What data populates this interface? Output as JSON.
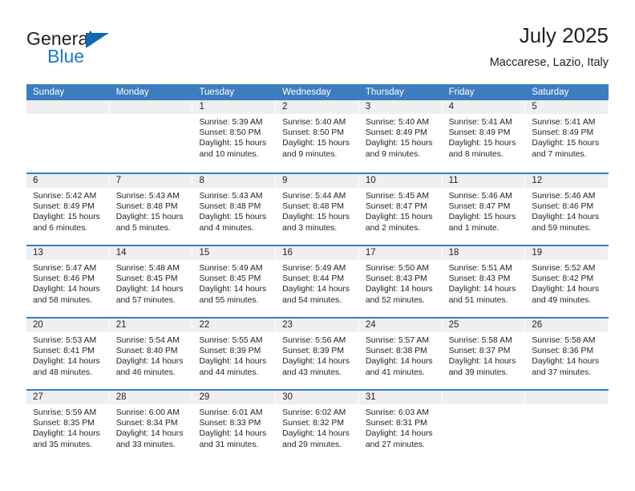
{
  "brand": {
    "name_part1": "General",
    "name_part2": "Blue",
    "triangle_color": "#1068b5",
    "blue_text_color": "#1f7ac4"
  },
  "header": {
    "title": "July 2025",
    "subtitle": "Maccarese, Lazio, Italy"
  },
  "theme": {
    "header_blue": "#3b7dbf",
    "daynum_band": "#efefef",
    "text": "#231f20"
  },
  "weekdays": [
    "Sunday",
    "Monday",
    "Tuesday",
    "Wednesday",
    "Thursday",
    "Friday",
    "Saturday"
  ],
  "weeks": [
    [
      {
        "day": "",
        "sunrise": "",
        "sunset": "",
        "daylight1": "",
        "daylight2": ""
      },
      {
        "day": "",
        "sunrise": "",
        "sunset": "",
        "daylight1": "",
        "daylight2": ""
      },
      {
        "day": "1",
        "sunrise": "Sunrise: 5:39 AM",
        "sunset": "Sunset: 8:50 PM",
        "daylight1": "Daylight: 15 hours",
        "daylight2": "and 10 minutes."
      },
      {
        "day": "2",
        "sunrise": "Sunrise: 5:40 AM",
        "sunset": "Sunset: 8:50 PM",
        "daylight1": "Daylight: 15 hours",
        "daylight2": "and 9 minutes."
      },
      {
        "day": "3",
        "sunrise": "Sunrise: 5:40 AM",
        "sunset": "Sunset: 8:49 PM",
        "daylight1": "Daylight: 15 hours",
        "daylight2": "and 9 minutes."
      },
      {
        "day": "4",
        "sunrise": "Sunrise: 5:41 AM",
        "sunset": "Sunset: 8:49 PM",
        "daylight1": "Daylight: 15 hours",
        "daylight2": "and 8 minutes."
      },
      {
        "day": "5",
        "sunrise": "Sunrise: 5:41 AM",
        "sunset": "Sunset: 8:49 PM",
        "daylight1": "Daylight: 15 hours",
        "daylight2": "and 7 minutes."
      }
    ],
    [
      {
        "day": "6",
        "sunrise": "Sunrise: 5:42 AM",
        "sunset": "Sunset: 8:49 PM",
        "daylight1": "Daylight: 15 hours",
        "daylight2": "and 6 minutes."
      },
      {
        "day": "7",
        "sunrise": "Sunrise: 5:43 AM",
        "sunset": "Sunset: 8:48 PM",
        "daylight1": "Daylight: 15 hours",
        "daylight2": "and 5 minutes."
      },
      {
        "day": "8",
        "sunrise": "Sunrise: 5:43 AM",
        "sunset": "Sunset: 8:48 PM",
        "daylight1": "Daylight: 15 hours",
        "daylight2": "and 4 minutes."
      },
      {
        "day": "9",
        "sunrise": "Sunrise: 5:44 AM",
        "sunset": "Sunset: 8:48 PM",
        "daylight1": "Daylight: 15 hours",
        "daylight2": "and 3 minutes."
      },
      {
        "day": "10",
        "sunrise": "Sunrise: 5:45 AM",
        "sunset": "Sunset: 8:47 PM",
        "daylight1": "Daylight: 15 hours",
        "daylight2": "and 2 minutes."
      },
      {
        "day": "11",
        "sunrise": "Sunrise: 5:46 AM",
        "sunset": "Sunset: 8:47 PM",
        "daylight1": "Daylight: 15 hours",
        "daylight2": "and 1 minute."
      },
      {
        "day": "12",
        "sunrise": "Sunrise: 5:46 AM",
        "sunset": "Sunset: 8:46 PM",
        "daylight1": "Daylight: 14 hours",
        "daylight2": "and 59 minutes."
      }
    ],
    [
      {
        "day": "13",
        "sunrise": "Sunrise: 5:47 AM",
        "sunset": "Sunset: 8:46 PM",
        "daylight1": "Daylight: 14 hours",
        "daylight2": "and 58 minutes."
      },
      {
        "day": "14",
        "sunrise": "Sunrise: 5:48 AM",
        "sunset": "Sunset: 8:45 PM",
        "daylight1": "Daylight: 14 hours",
        "daylight2": "and 57 minutes."
      },
      {
        "day": "15",
        "sunrise": "Sunrise: 5:49 AM",
        "sunset": "Sunset: 8:45 PM",
        "daylight1": "Daylight: 14 hours",
        "daylight2": "and 55 minutes."
      },
      {
        "day": "16",
        "sunrise": "Sunrise: 5:49 AM",
        "sunset": "Sunset: 8:44 PM",
        "daylight1": "Daylight: 14 hours",
        "daylight2": "and 54 minutes."
      },
      {
        "day": "17",
        "sunrise": "Sunrise: 5:50 AM",
        "sunset": "Sunset: 8:43 PM",
        "daylight1": "Daylight: 14 hours",
        "daylight2": "and 52 minutes."
      },
      {
        "day": "18",
        "sunrise": "Sunrise: 5:51 AM",
        "sunset": "Sunset: 8:43 PM",
        "daylight1": "Daylight: 14 hours",
        "daylight2": "and 51 minutes."
      },
      {
        "day": "19",
        "sunrise": "Sunrise: 5:52 AM",
        "sunset": "Sunset: 8:42 PM",
        "daylight1": "Daylight: 14 hours",
        "daylight2": "and 49 minutes."
      }
    ],
    [
      {
        "day": "20",
        "sunrise": "Sunrise: 5:53 AM",
        "sunset": "Sunset: 8:41 PM",
        "daylight1": "Daylight: 14 hours",
        "daylight2": "and 48 minutes."
      },
      {
        "day": "21",
        "sunrise": "Sunrise: 5:54 AM",
        "sunset": "Sunset: 8:40 PM",
        "daylight1": "Daylight: 14 hours",
        "daylight2": "and 46 minutes."
      },
      {
        "day": "22",
        "sunrise": "Sunrise: 5:55 AM",
        "sunset": "Sunset: 8:39 PM",
        "daylight1": "Daylight: 14 hours",
        "daylight2": "and 44 minutes."
      },
      {
        "day": "23",
        "sunrise": "Sunrise: 5:56 AM",
        "sunset": "Sunset: 8:39 PM",
        "daylight1": "Daylight: 14 hours",
        "daylight2": "and 43 minutes."
      },
      {
        "day": "24",
        "sunrise": "Sunrise: 5:57 AM",
        "sunset": "Sunset: 8:38 PM",
        "daylight1": "Daylight: 14 hours",
        "daylight2": "and 41 minutes."
      },
      {
        "day": "25",
        "sunrise": "Sunrise: 5:58 AM",
        "sunset": "Sunset: 8:37 PM",
        "daylight1": "Daylight: 14 hours",
        "daylight2": "and 39 minutes."
      },
      {
        "day": "26",
        "sunrise": "Sunrise: 5:58 AM",
        "sunset": "Sunset: 8:36 PM",
        "daylight1": "Daylight: 14 hours",
        "daylight2": "and 37 minutes."
      }
    ],
    [
      {
        "day": "27",
        "sunrise": "Sunrise: 5:59 AM",
        "sunset": "Sunset: 8:35 PM",
        "daylight1": "Daylight: 14 hours",
        "daylight2": "and 35 minutes."
      },
      {
        "day": "28",
        "sunrise": "Sunrise: 6:00 AM",
        "sunset": "Sunset: 8:34 PM",
        "daylight1": "Daylight: 14 hours",
        "daylight2": "and 33 minutes."
      },
      {
        "day": "29",
        "sunrise": "Sunrise: 6:01 AM",
        "sunset": "Sunset: 8:33 PM",
        "daylight1": "Daylight: 14 hours",
        "daylight2": "and 31 minutes."
      },
      {
        "day": "30",
        "sunrise": "Sunrise: 6:02 AM",
        "sunset": "Sunset: 8:32 PM",
        "daylight1": "Daylight: 14 hours",
        "daylight2": "and 29 minutes."
      },
      {
        "day": "31",
        "sunrise": "Sunrise: 6:03 AM",
        "sunset": "Sunset: 8:31 PM",
        "daylight1": "Daylight: 14 hours",
        "daylight2": "and 27 minutes."
      },
      {
        "day": "",
        "sunrise": "",
        "sunset": "",
        "daylight1": "",
        "daylight2": ""
      },
      {
        "day": "",
        "sunrise": "",
        "sunset": "",
        "daylight1": "",
        "daylight2": ""
      }
    ]
  ]
}
